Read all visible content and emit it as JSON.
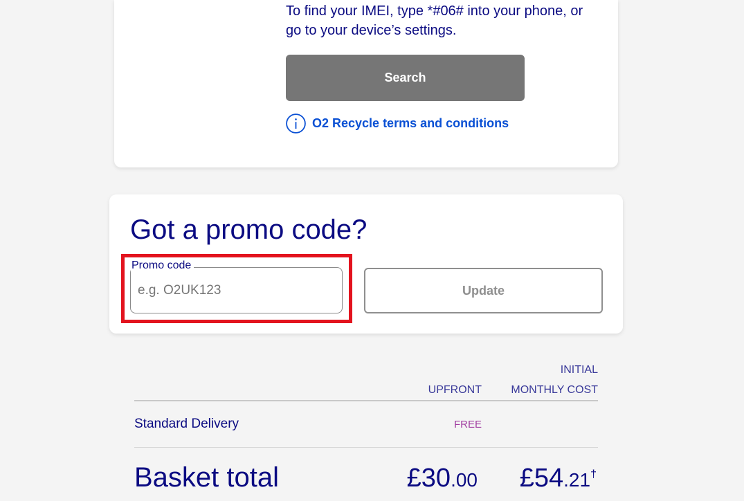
{
  "imei_card": {
    "help_text": "To find your IMEI, type *#06# into your phone, or go to your device’s settings.",
    "search_button": "Search",
    "terms_link": {
      "icon": "info-icon",
      "label": "O2 Recycle terms and conditions"
    }
  },
  "promo": {
    "heading": "Got a promo code?",
    "field": {
      "label": "Promo code",
      "placeholder": "e.g. O2UK123",
      "value": ""
    },
    "update_button": "Update"
  },
  "summary": {
    "columns": {
      "upfront": "UPFRONT",
      "monthly_line1": "INITIAL",
      "monthly_line2": "MONTHLY COST"
    },
    "rows": [
      {
        "label": "Standard Delivery",
        "upfront": "FREE"
      }
    ],
    "total": {
      "label": "Basket total",
      "upfront": {
        "major": "£30",
        "minor": ".00"
      },
      "monthly": {
        "major": "£54",
        "minor": ".21",
        "mark": "†"
      }
    }
  },
  "colors": {
    "page_background": "#f4f4f4",
    "card_background": "#ffffff",
    "navy_text": "#0b0b82",
    "column_label": "#3a3a9a",
    "link_blue": "#0a50d4",
    "search_button": "#767676",
    "disabled_gray": "#8f8f8f",
    "free_label": "#a03ca0",
    "highlight_red": "#e3131e"
  }
}
